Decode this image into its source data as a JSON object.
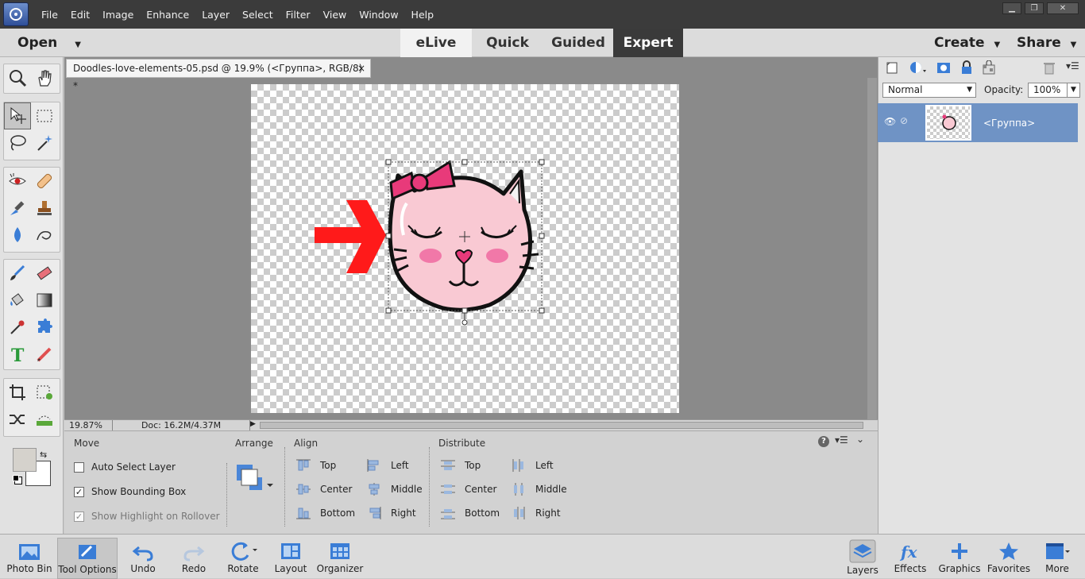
{
  "menubar": {
    "items": [
      "File",
      "Edit",
      "Image",
      "Enhance",
      "Layer",
      "Select",
      "Filter",
      "View",
      "Window",
      "Help"
    ]
  },
  "modebar": {
    "open_label": "Open",
    "tabs": [
      "eLive",
      "Quick",
      "Guided",
      "Expert"
    ],
    "active_tab": "Expert",
    "create_label": "Create",
    "share_label": "Share"
  },
  "document": {
    "tab_title": "Doodles-love-elements-05.psd @ 19.9% (<Группа>, RGB/8) *",
    "close_glyph": "×",
    "zoom": "19.87%",
    "doc_size": "Doc: 16.2M/4.37M"
  },
  "layers_panel": {
    "blend_mode": "Normal",
    "opacity_label": "Opacity:",
    "opacity_value": "100%",
    "layers": [
      {
        "name": "<Группа>"
      }
    ]
  },
  "tool_options": {
    "move_label": "Move",
    "auto_select": "Auto Select Layer",
    "show_bounding_box": "Show Bounding Box",
    "show_highlight": "Show Highlight on Rollover",
    "auto_select_checked": false,
    "bounding_box_checked": true,
    "highlight_checked": true,
    "arrange_label": "Arrange",
    "align_label": "Align",
    "align_vertical": [
      "Top",
      "Center",
      "Bottom"
    ],
    "align_horizontal": [
      "Left",
      "Middle",
      "Right"
    ],
    "distribute_label": "Distribute",
    "distribute_vertical": [
      "Top",
      "Center",
      "Bottom"
    ],
    "distribute_horizontal": [
      "Left",
      "Middle",
      "Right"
    ]
  },
  "bottombar": {
    "left": [
      "Photo Bin",
      "Tool Options",
      "Undo",
      "Redo",
      "Rotate",
      "Layout",
      "Organizer"
    ],
    "right": [
      "Layers",
      "Effects",
      "Graphics",
      "Favorites",
      "More"
    ]
  },
  "colors": {
    "menubar_bg": "#3b3b3b",
    "active_tab_bg": "#3a3a3a",
    "selected_layer_bg": "#6f93c5",
    "arrow_red": "#ff1a1a",
    "cat_pink": "#f9c9d3",
    "bow_magenta": "#e83a7a"
  }
}
